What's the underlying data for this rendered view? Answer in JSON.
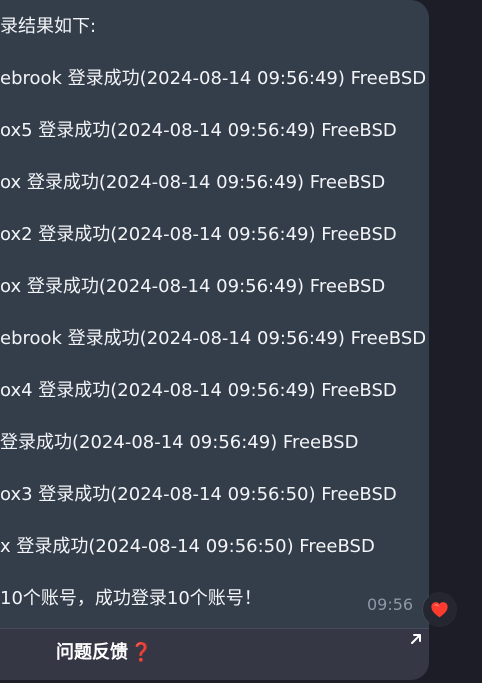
{
  "message": {
    "lines": [
      "录结果如下:",
      "ebrook 登录成功(2024-08-14 09:56:49) FreeBSD",
      "ox5 登录成功(2024-08-14 09:56:49) FreeBSD",
      "ox 登录成功(2024-08-14 09:56:49) FreeBSD",
      "ox2 登录成功(2024-08-14 09:56:49) FreeBSD",
      "ox 登录成功(2024-08-14 09:56:49) FreeBSD",
      "ebrook 登录成功(2024-08-14 09:56:49) FreeBSD",
      "ox4 登录成功(2024-08-14 09:56:49) FreeBSD",
      "登录成功(2024-08-14 09:56:49) FreeBSD",
      "ox3 登录成功(2024-08-14 09:56:50) FreeBSD",
      "x 登录成功(2024-08-14 09:56:50) FreeBSD",
      "10个账号，成功登录10个账号！"
    ],
    "time": "09:56"
  },
  "reaction": {
    "icon": "heart-icon",
    "color": "#ff3b30"
  },
  "feedback_button": {
    "label": "问题反馈",
    "icon": "question-icon",
    "icon_glyph": "❓",
    "open_icon": "external-arrow-icon"
  }
}
